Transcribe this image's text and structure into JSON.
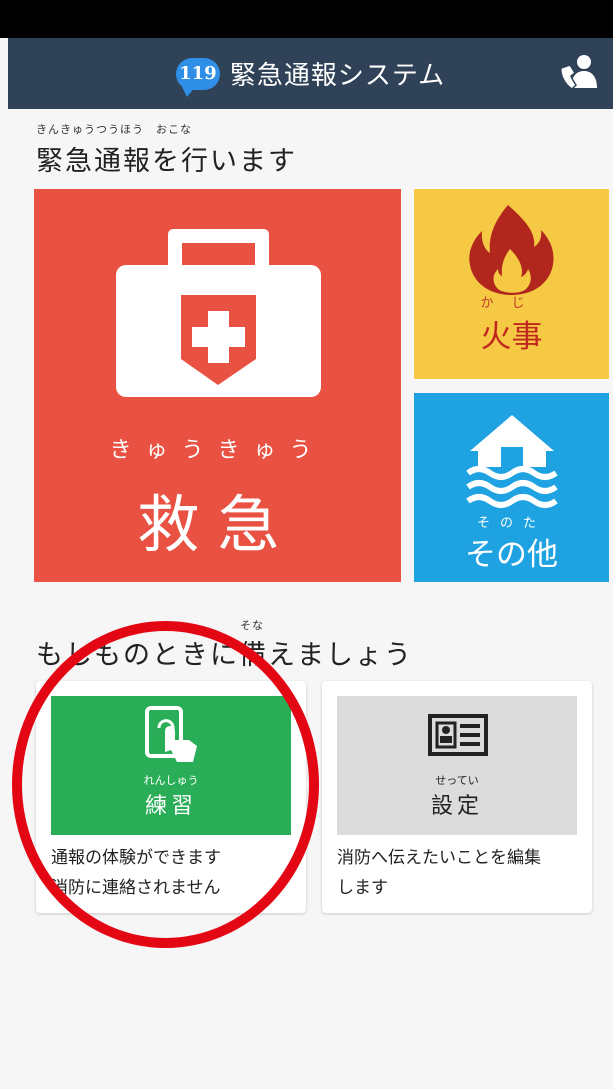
{
  "app_bar": {
    "badge": "119",
    "title": "緊急通報システム",
    "user_icon": "person-phone-icon"
  },
  "section1": {
    "ruby": "きんきゅうつうほう　おこな",
    "heading": "緊急通報を行います"
  },
  "tiles": {
    "kyukyu": {
      "ruby": "きゅうきゅう",
      "label": "救急",
      "icon": "first-aid-kit-icon",
      "color": "#e95142"
    },
    "fire": {
      "ruby": "かじ",
      "label": "火事",
      "icon": "fire-icon",
      "color": "#f6c944"
    },
    "other": {
      "ruby": "そのた",
      "label": "その他",
      "icon": "flood-house-icon",
      "color": "#1ea2e2"
    }
  },
  "section2": {
    "ruby": "そな",
    "heading": "もしものときに備えましょう"
  },
  "cards": {
    "practice": {
      "ruby": "れんしゅう",
      "label": "練習",
      "desc_line1": "通報の体験ができます",
      "desc_line2": "消防に連絡されません",
      "icon": "tablet-touch-icon",
      "color": "#29ad57"
    },
    "settings": {
      "ruby": "せってい",
      "label": "設定",
      "desc_line1": "消防へ伝えたいことを編集",
      "desc_line2": "します",
      "icon": "profile-card-icon"
    }
  },
  "annotation": {
    "highlight_color": "#e30613"
  }
}
